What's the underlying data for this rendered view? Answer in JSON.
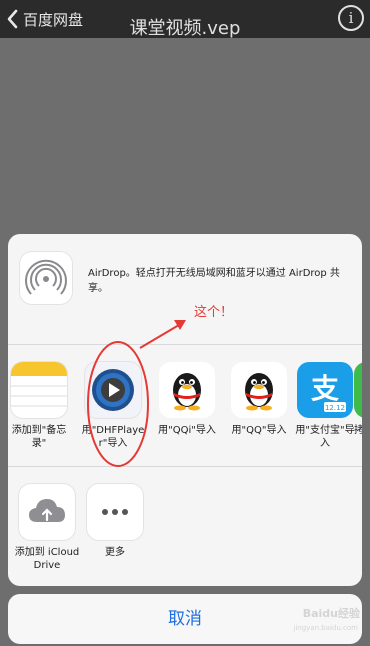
{
  "topbar": {
    "back_label": "百度网盘",
    "title": "课堂视频.vep"
  },
  "airdrop": {
    "text": "AirDrop。轻点打开无线局域网和蓝牙以通过 AirDrop 共享。"
  },
  "apps": [
    {
      "label": "添加到\"备忘录\""
    },
    {
      "label": "用\"DHFPlayer\"导入"
    },
    {
      "label": "用\"QQi\"导入"
    },
    {
      "label": "用\"QQ\"导入"
    },
    {
      "label": "用\"支付宝\"导入"
    },
    {
      "label": "拷"
    }
  ],
  "actions": [
    {
      "label": "添加到 iCloud Drive"
    },
    {
      "label": "更多"
    }
  ],
  "cancel_label": "取消",
  "annotation": {
    "text": "这个！",
    "color": "#e53935"
  },
  "alipay_badge": "12.12",
  "watermark": {
    "brand": "Baidu经验",
    "url": "jingyan.baidu.com"
  },
  "colors": {
    "accent": "#1c6fe0",
    "topbar": "#2b2b2b"
  }
}
